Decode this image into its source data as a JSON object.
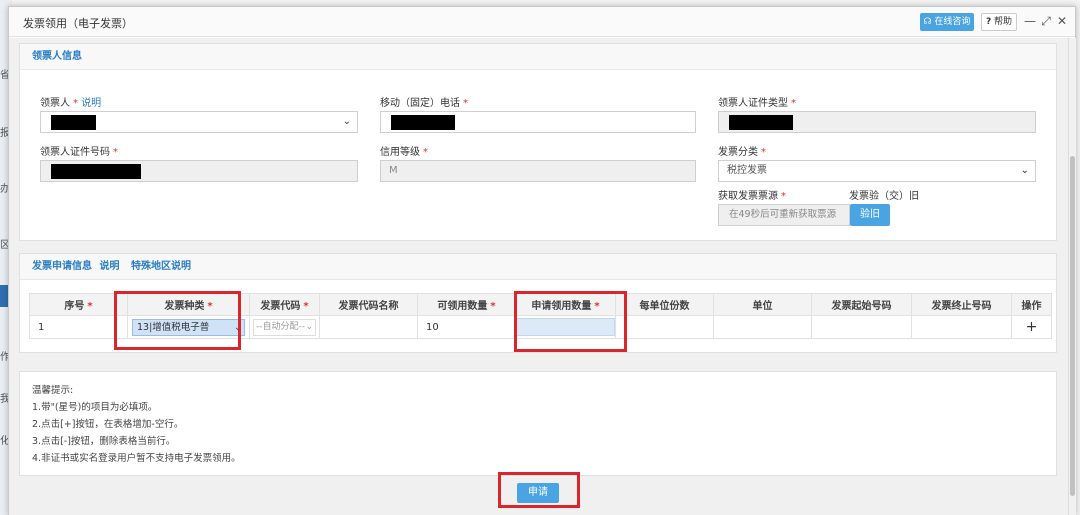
{
  "dialog": {
    "title": "发票领用（电子发票）",
    "consult_label": "在线咨询",
    "help_label": "帮助",
    "help_icon": "?",
    "minimize": "—",
    "maximize": "⤢",
    "close": "✕"
  },
  "background_glyphs": [
    "省",
    "报",
    "办",
    "区",
    "作",
    "我",
    "化"
  ],
  "receiver_section": {
    "title": "领票人信息",
    "receiver_label": "领票人",
    "explain_link": "说明",
    "phone_label": "移动（固定）电话",
    "id_type_label": "领票人证件类型",
    "id_number_label": "领票人证件号码",
    "credit_label": "信用等级",
    "credit_value": "M",
    "invoice_category_label": "发票分类",
    "invoice_category_value": "税控发票",
    "source_label": "获取发票票源",
    "source_placeholder": "在49秒后可重新获取票源",
    "check_label": "发票验（交）旧",
    "check_button": "验旧"
  },
  "apply_section": {
    "title": "发票申请信息",
    "explain_link": "说明",
    "special_link": "特殊地区说明"
  },
  "table": {
    "headers": [
      "序号",
      "发票种类",
      "发票代码",
      "发票代码名称",
      "可领用数量",
      "申请领用数量",
      "每单位份数",
      "单位",
      "发票起始号码",
      "发票终止号码",
      "操作"
    ],
    "required": [
      true,
      true,
      true,
      false,
      true,
      true,
      false,
      false,
      false,
      false,
      false
    ],
    "row": {
      "index": "1",
      "invoice_type": "13|增值税电子普",
      "code_placeholder": "--自动分配--",
      "code_name": "",
      "available": "10",
      "apply_qty": "",
      "per_unit": "",
      "unit": "",
      "start_no": "",
      "end_no": "",
      "action": "+"
    }
  },
  "tips": {
    "title": "温馨提示:",
    "lines": [
      "1.带\"(星号)的项目为必填项。",
      "2.点击[+]按钮，在表格增加-空行。",
      "3.点击[-]按钮，删除表格当前行。",
      "4.非证书或实名登录用户暂不支持电子发票领用。"
    ]
  },
  "submit_label": "申请",
  "required_mark": "*",
  "colors": {
    "accent": "#4aa3e3",
    "highlight": "#d9262d",
    "link": "#2a7dc4"
  }
}
